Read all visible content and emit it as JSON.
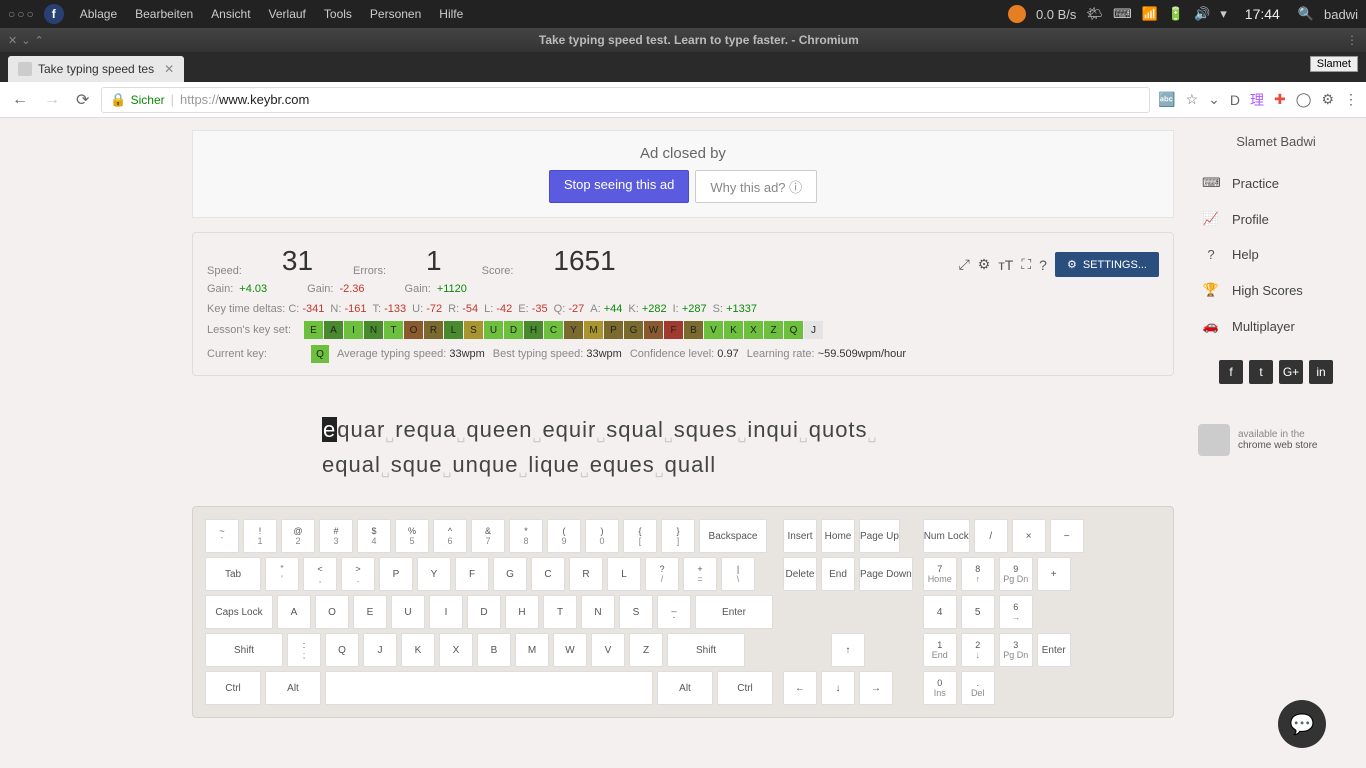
{
  "os": {
    "menus": [
      "Ablage",
      "Bearbeiten",
      "Ansicht",
      "Verlauf",
      "Tools",
      "Personen",
      "Hilfe"
    ],
    "net_speed": "0.0 B/s",
    "clock": "17:44",
    "search": "badwi"
  },
  "window": {
    "title": "Take typing speed test. Learn to type faster. - Chromium"
  },
  "tab": {
    "title": "Take typing speed tes",
    "user": "Slamet"
  },
  "url": {
    "secure_label": "Sicher",
    "proto": "https://",
    "host": "www.keybr.com"
  },
  "ad": {
    "closed_by": "Ad closed by",
    "stop": "Stop seeing this ad",
    "why": "Why this ad?"
  },
  "stats": {
    "speed_label": "Speed:",
    "speed": "31",
    "errors_label": "Errors:",
    "errors": "1",
    "score_label": "Score:",
    "score": "1651",
    "gain_label": "Gain:",
    "gain_speed": "+4.03",
    "gain_errors": "-2.36",
    "gain_score": "+1120",
    "settings": "SETTINGS..."
  },
  "deltas": {
    "label": "Key time deltas:",
    "items": [
      {
        "l": "C:",
        "v": "-341",
        "c": "red"
      },
      {
        "l": "N:",
        "v": "-161",
        "c": "red"
      },
      {
        "l": "T:",
        "v": "-133",
        "c": "red"
      },
      {
        "l": "U:",
        "v": "-72",
        "c": "red"
      },
      {
        "l": "R:",
        "v": "-54",
        "c": "red"
      },
      {
        "l": "L:",
        "v": "-42",
        "c": "red"
      },
      {
        "l": "E:",
        "v": "-35",
        "c": "red"
      },
      {
        "l": "Q:",
        "v": "-27",
        "c": "red"
      },
      {
        "l": "A:",
        "v": "+44",
        "c": "green"
      },
      {
        "l": "K:",
        "v": "+282",
        "c": "green"
      },
      {
        "l": "I:",
        "v": "+287",
        "c": "green"
      },
      {
        "l": "S:",
        "v": "+1337",
        "c": "green"
      }
    ]
  },
  "keyset": {
    "label": "Lesson's key set:",
    "keys": [
      {
        "k": "E",
        "c": "kc-green"
      },
      {
        "k": "A",
        "c": "kc-dgreen"
      },
      {
        "k": "I",
        "c": "kc-green"
      },
      {
        "k": "N",
        "c": "kc-dgreen"
      },
      {
        "k": "T",
        "c": "kc-green"
      },
      {
        "k": "O",
        "c": "kc-brown"
      },
      {
        "k": "R",
        "c": "kc-olive"
      },
      {
        "k": "L",
        "c": "kc-dgreen"
      },
      {
        "k": "S",
        "c": "kc-dyellow"
      },
      {
        "k": "U",
        "c": "kc-green"
      },
      {
        "k": "D",
        "c": "kc-green"
      },
      {
        "k": "H",
        "c": "kc-dgreen"
      },
      {
        "k": "C",
        "c": "kc-green"
      },
      {
        "k": "Y",
        "c": "kc-olive"
      },
      {
        "k": "M",
        "c": "kc-dyellow"
      },
      {
        "k": "P",
        "c": "kc-olive"
      },
      {
        "k": "G",
        "c": "kc-olive"
      },
      {
        "k": "W",
        "c": "kc-brown"
      },
      {
        "k": "F",
        "c": "kc-red"
      },
      {
        "k": "B",
        "c": "kc-olive"
      },
      {
        "k": "V",
        "c": "kc-green"
      },
      {
        "k": "K",
        "c": "kc-green"
      },
      {
        "k": "X",
        "c": "kc-green"
      },
      {
        "k": "Z",
        "c": "kc-green"
      },
      {
        "k": "Q",
        "c": "kc-green"
      },
      {
        "k": "J",
        "c": "kc-gray"
      }
    ]
  },
  "current": {
    "label": "Current key:",
    "key": "Q",
    "avg_label": "Average typing speed:",
    "avg": "33wpm",
    "best_label": "Best typing speed:",
    "best": "33wpm",
    "conf_label": "Confidence level:",
    "conf": "0.97",
    "learn_label": "Learning rate:",
    "learn": "~59.509wpm/hour"
  },
  "typing": {
    "cursor": "e",
    "line1_rest": "quar␣requa␣queen␣equir␣squal␣sques␣inqui␣quots␣",
    "line2": "equal␣sque␣unque␣lique␣eques␣quall"
  },
  "sidebar": {
    "name": "Slamet Badwi",
    "items": [
      {
        "icon": "⌨",
        "label": "Practice"
      },
      {
        "icon": "📈",
        "label": "Profile"
      },
      {
        "icon": "?",
        "label": "Help"
      },
      {
        "icon": "🏆",
        "label": "High Scores"
      },
      {
        "icon": "🚗",
        "label": "Multiplayer"
      }
    ],
    "webstore1": "available in the",
    "webstore2": "chrome web store"
  },
  "kbd": {
    "row1": [
      [
        "~",
        "`"
      ],
      [
        "!",
        "1"
      ],
      [
        "@",
        "2"
      ],
      [
        "#",
        "3"
      ],
      [
        "$",
        "4"
      ],
      [
        "%",
        "5"
      ],
      [
        "^",
        "6"
      ],
      [
        "&",
        "7"
      ],
      [
        "*",
        "8"
      ],
      [
        "(",
        "9"
      ],
      [
        ")",
        "0"
      ],
      [
        "{",
        "["
      ],
      [
        "}",
        "]"
      ]
    ],
    "row2": [
      [
        "\"",
        "'"
      ],
      [
        "<",
        ","
      ],
      [
        ">",
        "."
      ],
      [
        "P",
        ""
      ],
      [
        "Y",
        ""
      ],
      [
        "F",
        ""
      ],
      [
        "G",
        ""
      ],
      [
        "C",
        ""
      ],
      [
        "R",
        ""
      ],
      [
        "L",
        ""
      ],
      [
        "?",
        "/"
      ],
      [
        "+",
        "="
      ],
      [
        "|",
        "\\"
      ]
    ],
    "row3": [
      [
        "A",
        ""
      ],
      [
        "O",
        ""
      ],
      [
        "E",
        ""
      ],
      [
        "U",
        ""
      ],
      [
        "I",
        ""
      ],
      [
        "D",
        ""
      ],
      [
        "H",
        ""
      ],
      [
        "T",
        ""
      ],
      [
        "N",
        ""
      ],
      [
        "S",
        ""
      ],
      [
        "_",
        "-"
      ]
    ],
    "row4": [
      [
        ":",
        ";"
      ],
      [
        "Q",
        ""
      ],
      [
        "J",
        ""
      ],
      [
        "K",
        ""
      ],
      [
        "X",
        ""
      ],
      [
        "B",
        ""
      ],
      [
        "M",
        ""
      ],
      [
        "W",
        ""
      ],
      [
        "V",
        ""
      ],
      [
        "Z",
        ""
      ]
    ],
    "backspace": "Backspace",
    "tab": "Tab",
    "caps": "Caps Lock",
    "enter": "Enter",
    "shift": "Shift",
    "ctrl": "Ctrl",
    "alt": "Alt",
    "nav": {
      "insert": "Insert",
      "home": "Home",
      "pgup": "Page Up",
      "delete": "Delete",
      "end": "End",
      "pgdn": "Page Down"
    },
    "num": {
      "numlock": "Num Lock",
      "div": "/",
      "mul": "×",
      "sub": "−",
      "add": "+",
      "ent": "Enter",
      "7": "7",
      "8": "8",
      "9": "9",
      "4": "4",
      "5": "5",
      "6": "6",
      "1": "1",
      "2": "2",
      "3": "3",
      "0": "0",
      "dot": ".",
      "home": "Home",
      "up": "↑",
      "pgup": "Pg Dn",
      "left": "",
      "right": "→",
      "end": "End",
      "down": "↓",
      "pgdn": "Pg Dn",
      "ins": "Ins",
      "del": "Del"
    }
  }
}
